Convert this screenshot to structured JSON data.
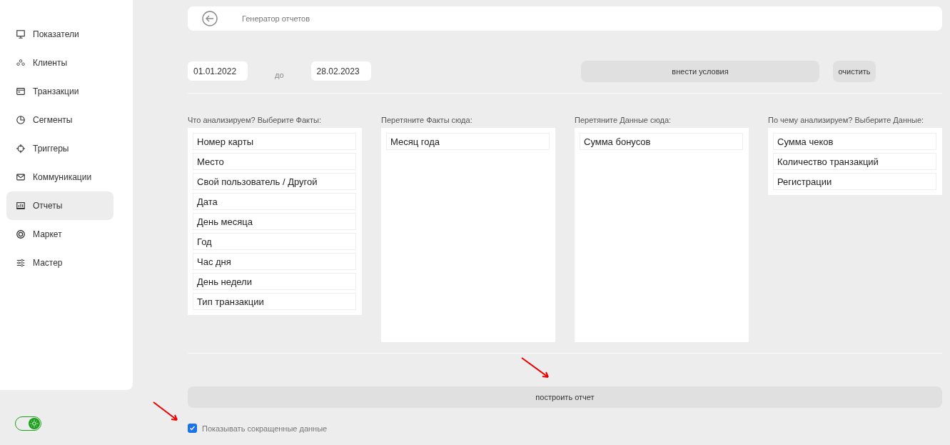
{
  "sidebar": {
    "items": [
      {
        "label": "Показатели",
        "selected": false
      },
      {
        "label": "Клиенты",
        "selected": false
      },
      {
        "label": "Транзакции",
        "selected": false
      },
      {
        "label": "Сегменты",
        "selected": false
      },
      {
        "label": "Триггеры",
        "selected": false
      },
      {
        "label": "Коммуникации",
        "selected": false
      },
      {
        "label": "Отчеты",
        "selected": true
      },
      {
        "label": "Маркет",
        "selected": false
      },
      {
        "label": "Мастер",
        "selected": false
      }
    ],
    "theme_toggle": {
      "on": true
    }
  },
  "header": {
    "title": "Генератор отчетов"
  },
  "filters": {
    "date_from": "01.01.2022",
    "separator": "до",
    "date_to": "28.02.2023",
    "apply_button": "внести условия",
    "clear_button": "очистить"
  },
  "columns": [
    {
      "title": "Что анализируем? Выберите Факты:",
      "kind": "list",
      "items": [
        "Номер карты",
        "Место",
        "Свой пользователь / Другой",
        "Дата",
        "День месяца",
        "Год",
        "Час дня",
        "День недели",
        "Тип транзакции"
      ]
    },
    {
      "title": "Перетяните Факты сюда:",
      "kind": "drop",
      "items": [
        "Месяц года"
      ]
    },
    {
      "title": "Перетяните Данные сюда:",
      "kind": "drop",
      "items": [
        "Сумма бонусов"
      ]
    },
    {
      "title": "По чему анализируем? Выберите Данные:",
      "kind": "list",
      "items": [
        "Сумма чеков",
        "Количество транзакций",
        "Регистрации"
      ]
    }
  ],
  "build_button": "построить отчет",
  "short_data": {
    "label": "Показывать сокращенные данные",
    "checked": true
  }
}
